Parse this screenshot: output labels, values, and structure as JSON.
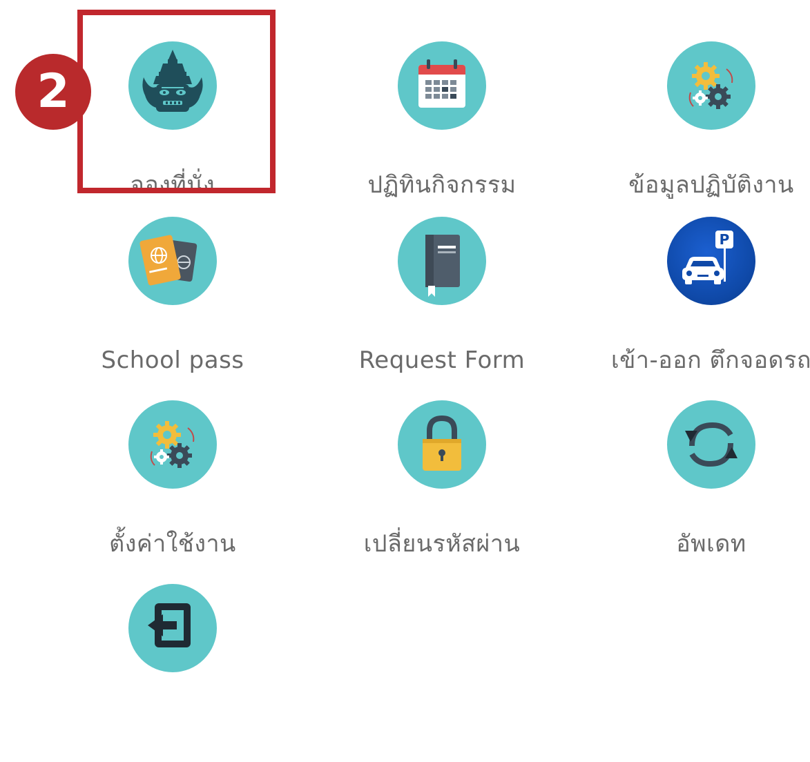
{
  "step_badge": "2",
  "menu": {
    "items": [
      {
        "label": "จองที่นั่ง",
        "icon": "garuda-mask-icon"
      },
      {
        "label": "ปฏิทินกิจกรรม",
        "icon": "calendar-icon"
      },
      {
        "label": "ข้อมูลปฏิบัติงาน",
        "icon": "gears-icon"
      },
      {
        "label": "School pass",
        "icon": "passport-icon"
      },
      {
        "label": "Request Form",
        "icon": "book-icon"
      },
      {
        "label": "เข้า-ออก ตึกจอดรถ",
        "icon": "parking-car-icon"
      },
      {
        "label": "ตั้งค่าใช้งาน",
        "icon": "settings-gears-icon"
      },
      {
        "label": "เปลี่ยนรหัสผ่าน",
        "icon": "padlock-icon"
      },
      {
        "label": "อัพเดท",
        "icon": "refresh-icon"
      },
      {
        "label": "",
        "icon": "logout-icon"
      }
    ]
  },
  "colors": {
    "teal": "#5fc7c9",
    "highlight_red": "#c1272d",
    "label_gray": "#6a6a6a",
    "parking_blue": "#0f49a8"
  }
}
